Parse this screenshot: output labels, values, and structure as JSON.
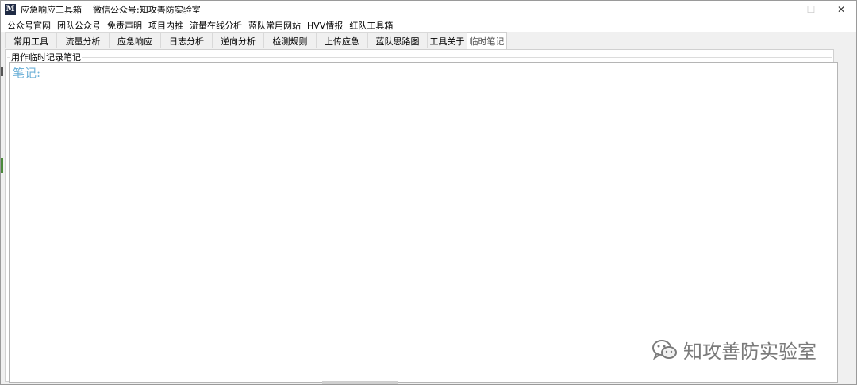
{
  "window": {
    "icon_letter": "M",
    "title": "应急响应工具箱    微信公众号:知攻善防实验室",
    "controls": {
      "minimize": "—",
      "maximize": "☐",
      "close": "✕"
    }
  },
  "menu": [
    "公众号官网",
    "团队公众号",
    "免责声明",
    "项目内推",
    "流量在线分析",
    "蓝队常用网站",
    "HVV情报",
    "红队工具箱"
  ],
  "tabs": [
    {
      "label": "常用工具",
      "active": false
    },
    {
      "label": "流量分析",
      "active": false
    },
    {
      "label": "应急响应",
      "active": false
    },
    {
      "label": "日志分析",
      "active": false
    },
    {
      "label": "逆向分析",
      "active": false
    },
    {
      "label": "检测规则",
      "active": false
    },
    {
      "label": "上传应急",
      "active": false
    },
    {
      "label": "蓝队思路图",
      "active": false
    },
    {
      "label": "工具关于",
      "active": false
    },
    {
      "label": "临时笔记",
      "active": true
    }
  ],
  "panel": {
    "group_label": "用作临时记录笔记",
    "note_text": "笔记:"
  },
  "watermark": {
    "text": "知攻善防实验室"
  },
  "colors": {
    "note_text": "#6fb2d8",
    "watermark": "#7a7a7a"
  }
}
